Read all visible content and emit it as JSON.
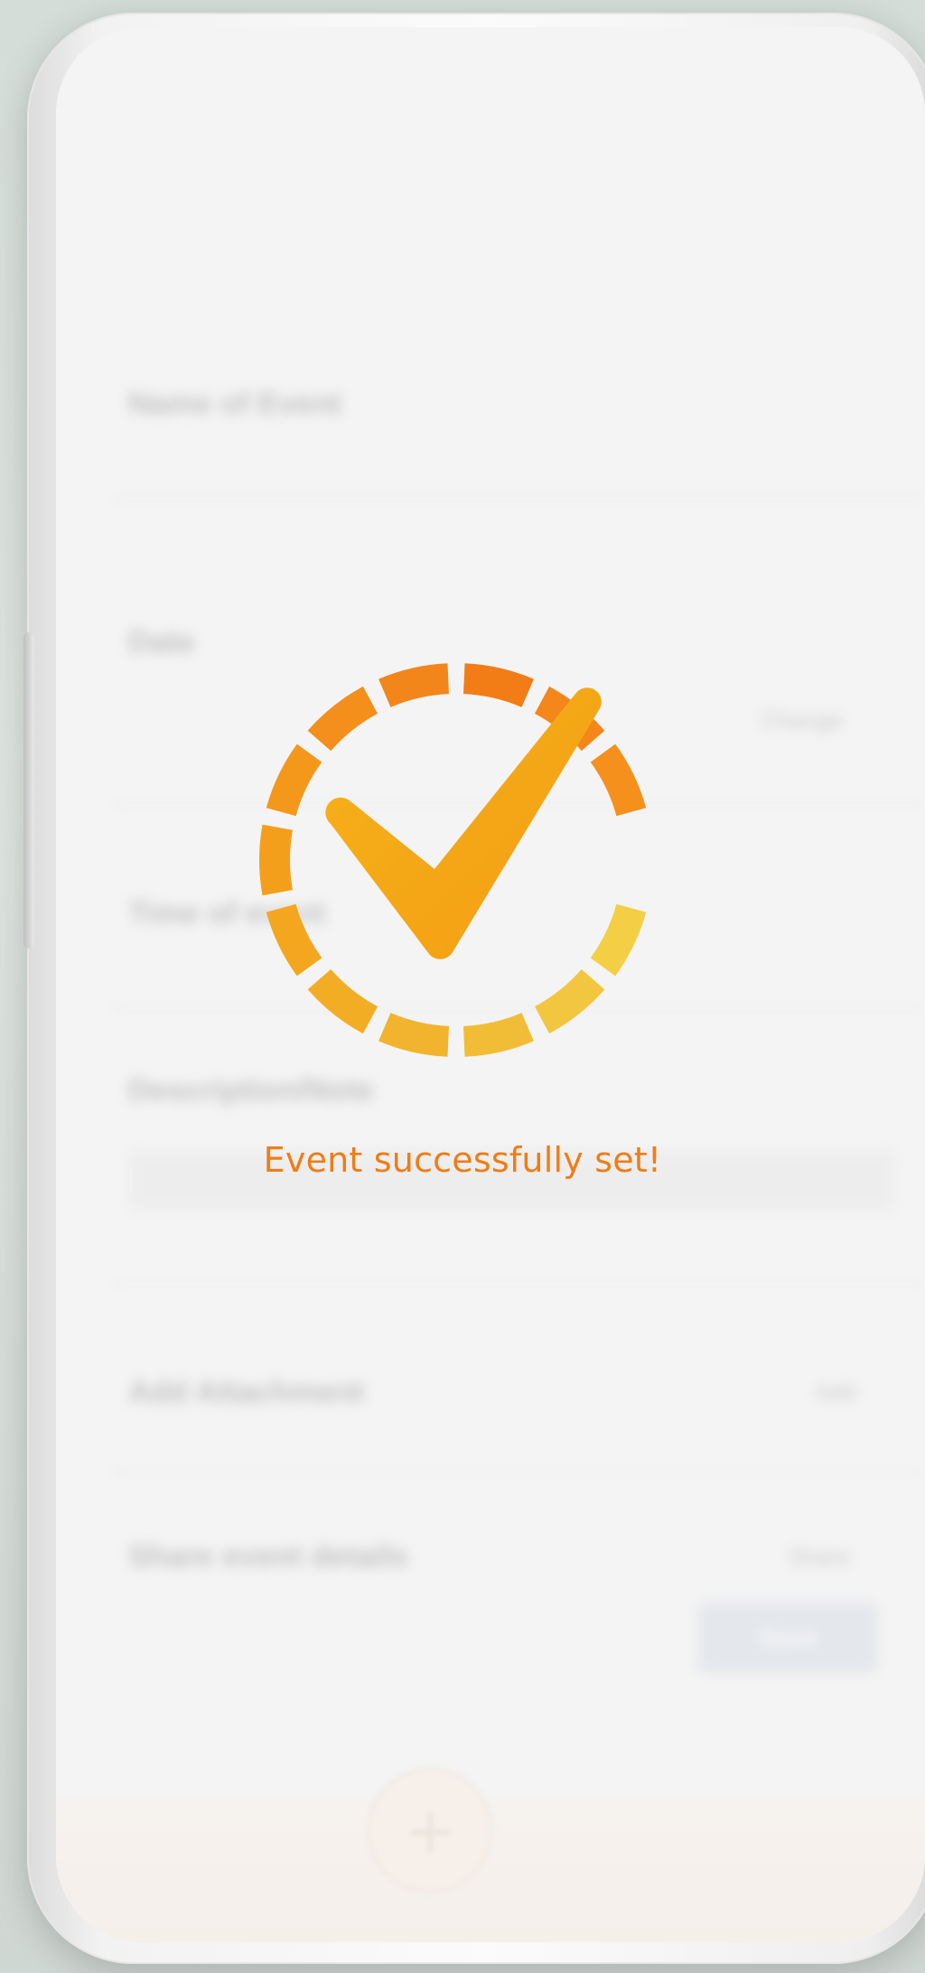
{
  "form": {
    "name_label": "Name of Event",
    "date_label": "Date",
    "date_action": "Change",
    "time_label": "Time of event",
    "description_label": "Description/Note",
    "attachment_label": "Add Attachment",
    "attachment_action": "Add",
    "share_label": "Share event details",
    "share_action": "Share",
    "save_label": "Save"
  },
  "overlay": {
    "message": "Event successfully set!",
    "icon": "check-badge-icon"
  },
  "colors": {
    "accent_orange": "#ef7d16",
    "ring_orange": "#f39a1e",
    "ring_yellow": "#f4cf45",
    "check": "#f3a515"
  },
  "fab": {
    "icon": "plus-icon",
    "glyph": "+"
  }
}
